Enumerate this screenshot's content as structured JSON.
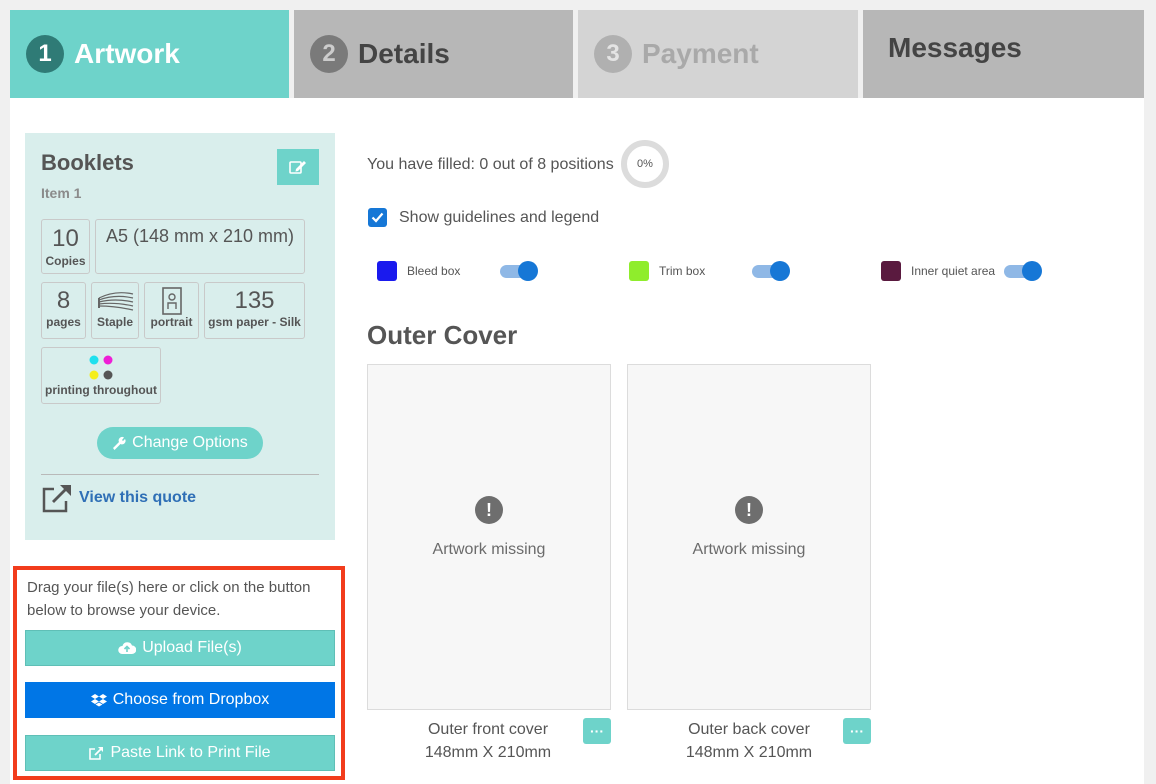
{
  "tabs": [
    {
      "num": "1",
      "label": "Artwork"
    },
    {
      "num": "2",
      "label": "Details"
    },
    {
      "num": "3",
      "label": "Payment"
    },
    {
      "label": "Messages"
    }
  ],
  "summary": {
    "title": "Booklets",
    "subtitle": "Item 1",
    "copies_value": "10",
    "copies_label": "Copies",
    "size": "A5 (148 mm x 210 mm)",
    "pages_value": "8",
    "pages_label": "pages",
    "binding_label": "Staple",
    "orientation_label": "portrait",
    "paper_value": "135",
    "paper_label": "gsm paper - Silk",
    "print_label": "printing throughout",
    "change_options": "Change Options",
    "view_quote": "View this quote"
  },
  "upload": {
    "instructions": "Drag your file(s) here or click on the button below to browse your device.",
    "upload_btn": "Upload File(s)",
    "dropbox_btn": "Choose from Dropbox",
    "link_btn": "Paste Link to Print File"
  },
  "progress": {
    "text": "You have filled: 0 out of 8 positions",
    "percent_label": "0%",
    "filled": 0,
    "total": 8
  },
  "guidelines": {
    "label": "Show guidelines and legend",
    "checked": true
  },
  "legend": [
    {
      "label": "Bleed box",
      "color": "#1a1aee",
      "on": true
    },
    {
      "label": "Trim box",
      "color": "#8fed2c",
      "on": true
    },
    {
      "label": "Inner quiet area",
      "color": "#5a1a3f",
      "on": true
    }
  ],
  "section": {
    "title": "Outer Cover"
  },
  "panels": [
    {
      "missing": "Artwork missing",
      "name": "Outer front cover",
      "size": "148mm X 210mm",
      "more": "···"
    },
    {
      "missing": "Artwork missing",
      "name": "Outer back cover",
      "size": "148mm X 210mm",
      "more": "···"
    }
  ],
  "colors": {
    "accent": "#6ed3ca",
    "dropbox": "#0076e6",
    "highlight": "#f23c1c",
    "link": "#2f6fb6"
  }
}
